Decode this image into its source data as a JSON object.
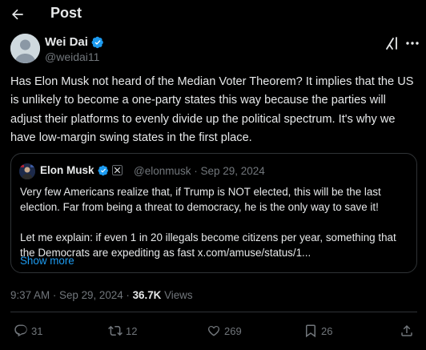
{
  "header": {
    "title": "Post"
  },
  "post": {
    "author_name": "Wei Dai",
    "author_handle": "@weidai11",
    "text": "Has Elon Musk not heard of the Median Voter Theorem? It implies that the US is unlikely to become a one-party states this way because the parties will adjust their platforms to evenly divide up the political spectrum. It's why we have low-margin swing states in the first place.",
    "time": "9:37 AM · Sep 29, 2024 · ",
    "views_count": "36.7K",
    "views_label": " Views"
  },
  "quote": {
    "author_name": "Elon Musk",
    "author_handle": "@elonmusk · Sep 29, 2024",
    "para1": "Very few Americans realize that, if Trump is NOT elected, this will be the last election. Far from being a threat to democracy, he is the only way to save it!",
    "para2": "Let me explain: if even 1 in 20 illegals become citizens per year, something that the Democrats are expediting as fast x.com/amuse/status/1...",
    "show_more": "Show more"
  },
  "actions": {
    "replies": "31",
    "reposts": "12",
    "likes": "269",
    "bookmarks": "26"
  },
  "colors": {
    "background": "#000000",
    "text": "#e7e9ea",
    "muted": "#71767b",
    "accent": "#1d9bf0",
    "border": "#2f3336"
  },
  "icons": {
    "back": "arrow-left-icon",
    "verified": "verified-badge-icon",
    "grok": "grok-icon",
    "more": "more-icon",
    "reply": "reply-icon",
    "repost": "repost-icon",
    "like": "heart-icon",
    "bookmark": "bookmark-icon",
    "share": "share-icon"
  }
}
